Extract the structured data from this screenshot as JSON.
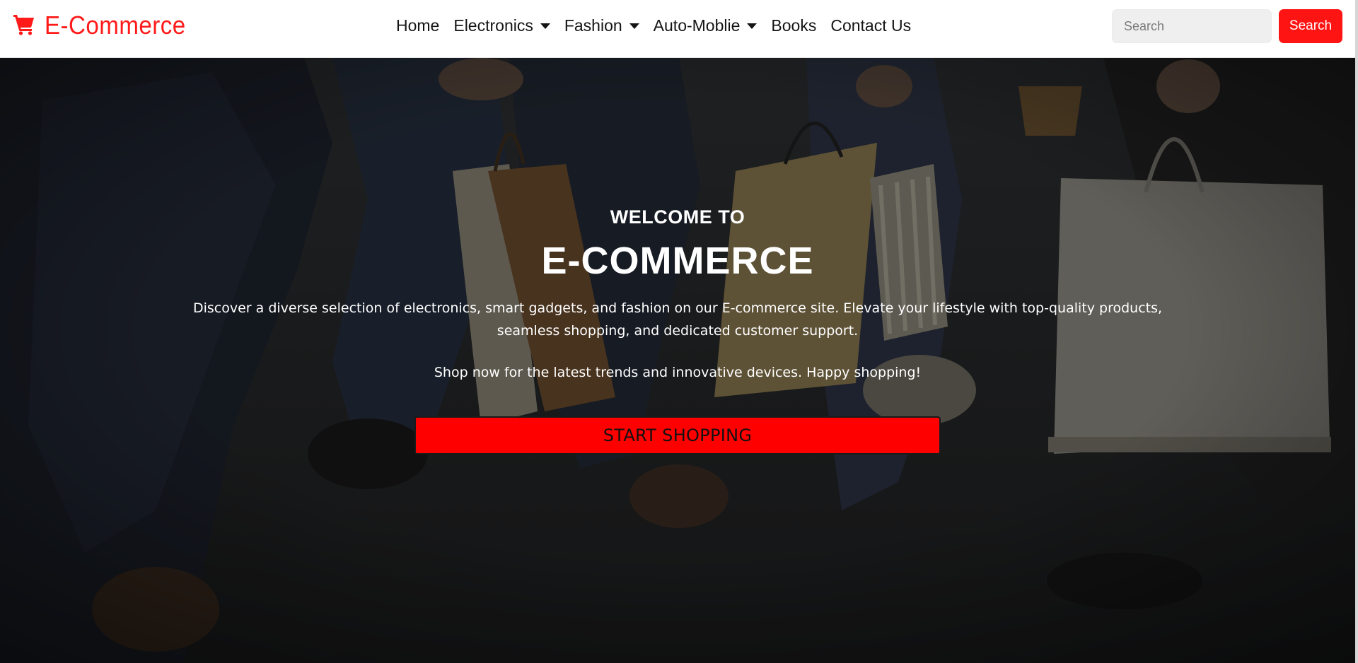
{
  "brand": {
    "name": "E-Commerce",
    "icon": "shopping-cart-icon",
    "color": "#ff1a1a"
  },
  "nav": {
    "items": [
      {
        "label": "Home",
        "dropdown": false
      },
      {
        "label": "Electronics",
        "dropdown": true
      },
      {
        "label": "Fashion",
        "dropdown": true
      },
      {
        "label": "Auto-Moblie",
        "dropdown": true
      },
      {
        "label": "Books",
        "dropdown": false
      },
      {
        "label": "Contact Us",
        "dropdown": false
      }
    ]
  },
  "search": {
    "placeholder": "Search",
    "value": "",
    "button_label": "Search",
    "button_color": "#ff1414"
  },
  "hero": {
    "welcome": "WELCOME TO",
    "title": "E-COMMERCE",
    "description": "Discover a diverse selection of electronics, smart gadgets, and fashion on our E-commerce site. Elevate your lifestyle with top-quality products, seamless shopping, and dedicated customer support.",
    "tagline": "Shop now for the latest trends and innovative devices. Happy shopping!",
    "cta_label": "START SHOPPING",
    "cta_color": "#ff0000"
  }
}
